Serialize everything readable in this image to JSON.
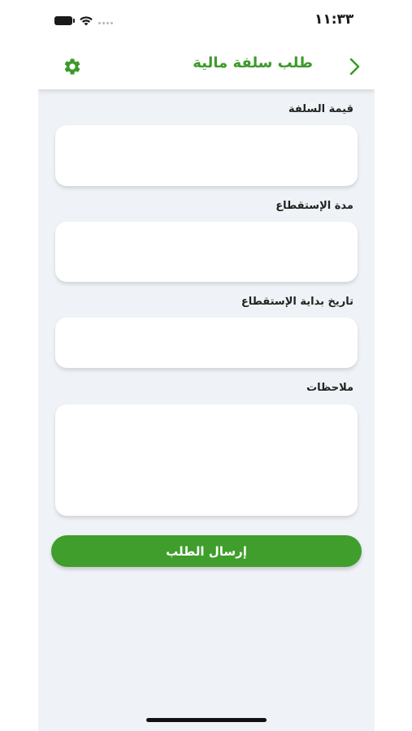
{
  "status_bar": {
    "time": "١١:٣٣",
    "icons": [
      "battery-icon",
      "wifi-icon",
      "signal-icon"
    ]
  },
  "header": {
    "title": "طلب سلفة مالية",
    "left_icon": "gear-icon",
    "right_icon": "chevron-right-icon"
  },
  "form": {
    "fields": [
      {
        "label": "قيمة السلفة",
        "value": "",
        "placeholder": ""
      },
      {
        "label": "مدة الإستقطاع",
        "value": "",
        "placeholder": ""
      },
      {
        "label": "تاريخ بداية الإستقطاع",
        "value": "",
        "placeholder": ""
      },
      {
        "label": "ملاحظات",
        "value": "",
        "placeholder": ""
      }
    ],
    "submit_label": "إرسال الطلب"
  },
  "colors": {
    "accent": "#3c9a2b",
    "background": "#eff2f6",
    "field_background": "#ffffff"
  }
}
